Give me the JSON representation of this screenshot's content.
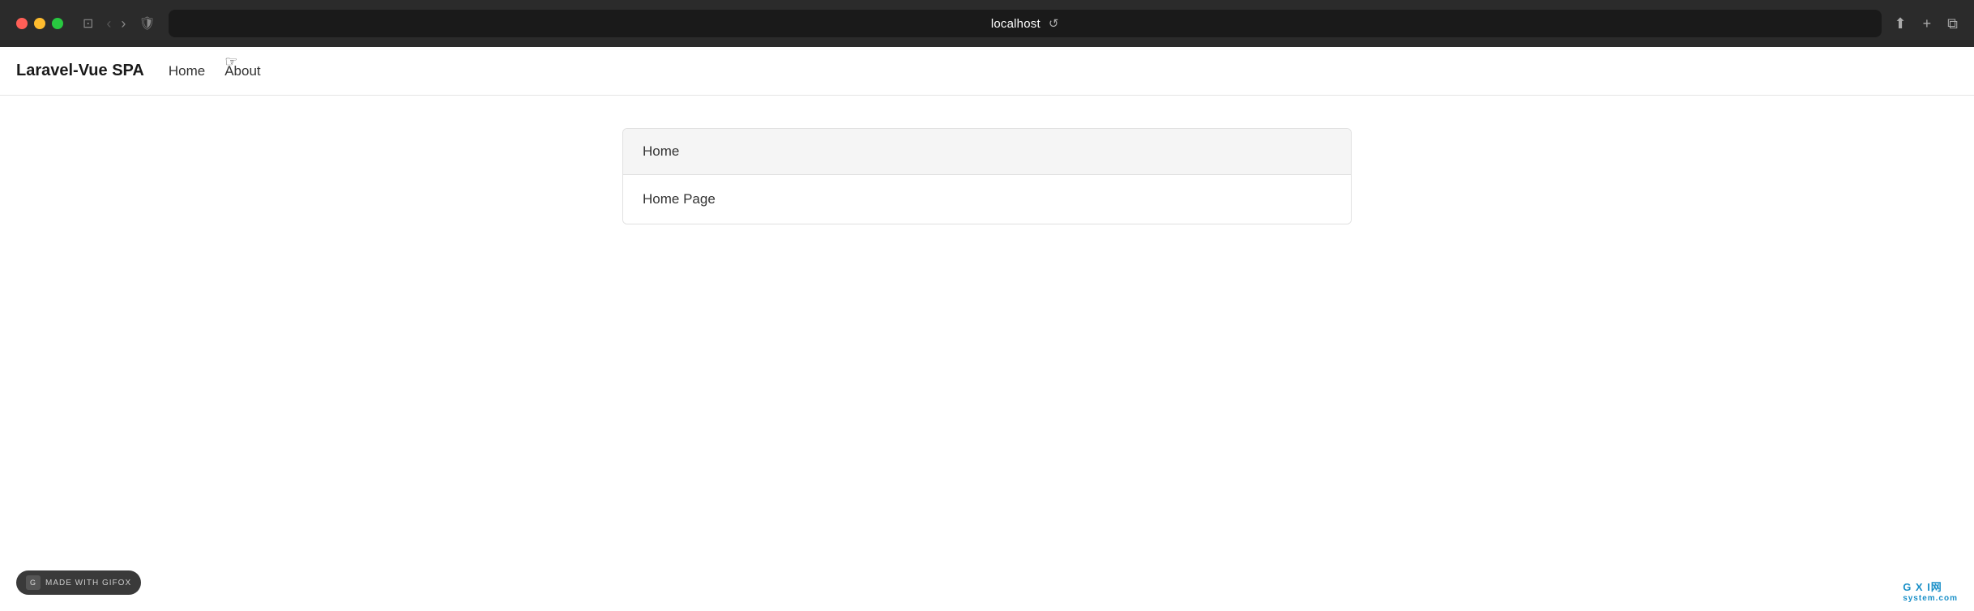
{
  "browser": {
    "address": "localhost",
    "reload_label": "⟳"
  },
  "app": {
    "brand": "Laravel-Vue SPA",
    "nav": {
      "home_label": "Home",
      "about_label": "About"
    },
    "card": {
      "header": "Home",
      "body": "Home Page"
    }
  },
  "footer": {
    "watermark_label": "MADE WITH GIFOX",
    "gxi_label": "G X I网",
    "gxi_sub": "system.com"
  },
  "icons": {
    "close": "●",
    "minimize": "●",
    "maximize": "●",
    "sidebar": "⊡",
    "back": "‹",
    "forward": "›",
    "shield": "⊕",
    "share": "⬆",
    "new_tab": "+",
    "windows": "⧉"
  }
}
